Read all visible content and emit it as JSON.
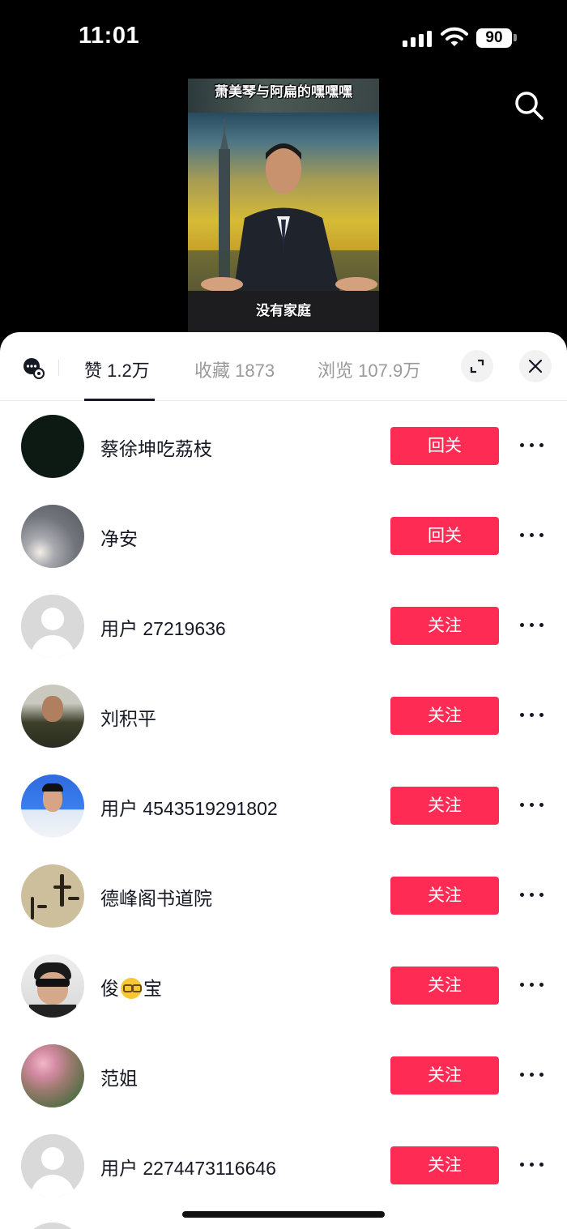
{
  "status_bar": {
    "time": "11:01",
    "battery": "90"
  },
  "video": {
    "caption_top": "萧美琴与阿扁的嘿嘿嘿",
    "caption_bottom": "没有家庭"
  },
  "tabs": [
    {
      "label": "赞",
      "count": "1.2万",
      "active": true
    },
    {
      "label": "收藏",
      "count": "1873",
      "active": false
    },
    {
      "label": "浏览",
      "count": "107.9万",
      "active": false
    }
  ],
  "users": [
    {
      "name": "蔡徐坤吃荔枝",
      "button": "回关",
      "avatar": "dark"
    },
    {
      "name": "净安",
      "button": "回关",
      "avatar": "sky"
    },
    {
      "name": "用户 27219636",
      "button": "关注",
      "avatar": "default"
    },
    {
      "name": "刘积平",
      "button": "关注",
      "avatar": "man1"
    },
    {
      "name": "用户 4543519291802",
      "button": "关注",
      "avatar": "man2"
    },
    {
      "name": "德峰阁书道院",
      "button": "关注",
      "avatar": "calligraphy"
    },
    {
      "name_before": "俊",
      "name_emoji": "nerd-face-emoji",
      "name_after": "宝",
      "button": "关注",
      "avatar": "boy"
    },
    {
      "name": "范姐",
      "button": "关注",
      "avatar": "flower"
    },
    {
      "name": "用户 2274473116646",
      "button": "关注",
      "avatar": "default"
    }
  ],
  "icons": {
    "search": "search-icon",
    "chat": "message-settings-icon",
    "expand": "expand-icon",
    "close": "close-icon",
    "more": "more-icon"
  },
  "colors": {
    "accent": "#fe2c55",
    "text": "#161823",
    "muted": "#9a9a9a"
  }
}
